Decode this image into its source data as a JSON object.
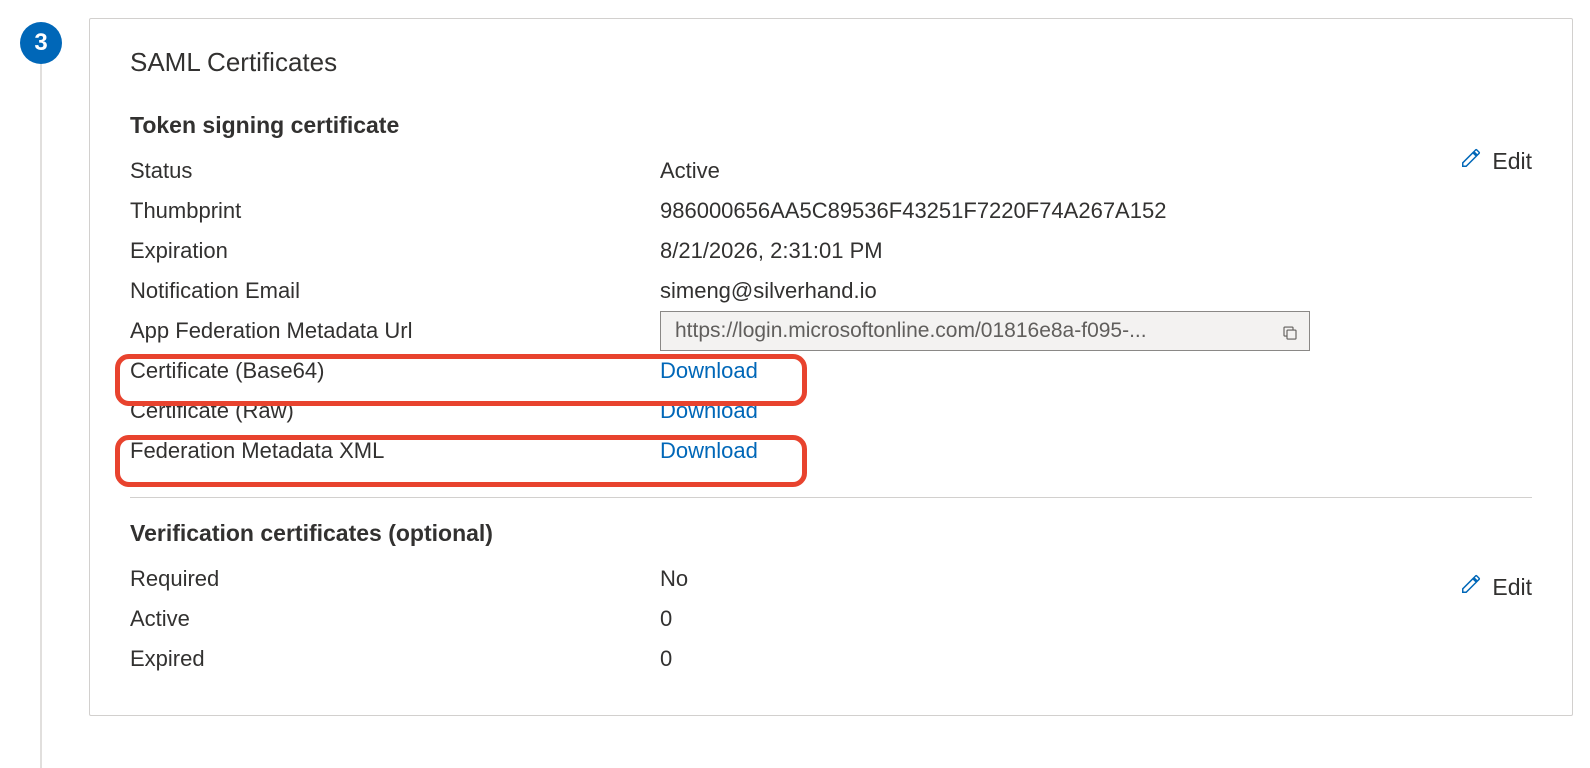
{
  "step_number": "3",
  "card": {
    "title": "SAML Certificates",
    "edit_label": "Edit"
  },
  "token_signing": {
    "heading": "Token signing certificate",
    "rows": {
      "status": {
        "label": "Status",
        "value": "Active"
      },
      "thumbprint": {
        "label": "Thumbprint",
        "value": "986000656AA5C89536F43251F7220F74A267A152"
      },
      "expiration": {
        "label": "Expiration",
        "value": "8/21/2026, 2:31:01 PM"
      },
      "notification_email": {
        "label": "Notification Email",
        "value": "simeng@silverhand.io"
      },
      "federation_url": {
        "label": "App Federation Metadata Url",
        "value": "https://login.microsoftonline.com/01816e8a-f095-..."
      },
      "cert_base64": {
        "label": "Certificate (Base64)",
        "action": "Download"
      },
      "cert_raw": {
        "label": "Certificate (Raw)",
        "action": "Download"
      },
      "metadata_xml": {
        "label": "Federation Metadata XML",
        "action": "Download"
      }
    }
  },
  "verification": {
    "heading": "Verification certificates (optional)",
    "rows": {
      "required": {
        "label": "Required",
        "value": "No"
      },
      "active": {
        "label": "Active",
        "value": "0"
      },
      "expired": {
        "label": "Expired",
        "value": "0"
      }
    }
  }
}
